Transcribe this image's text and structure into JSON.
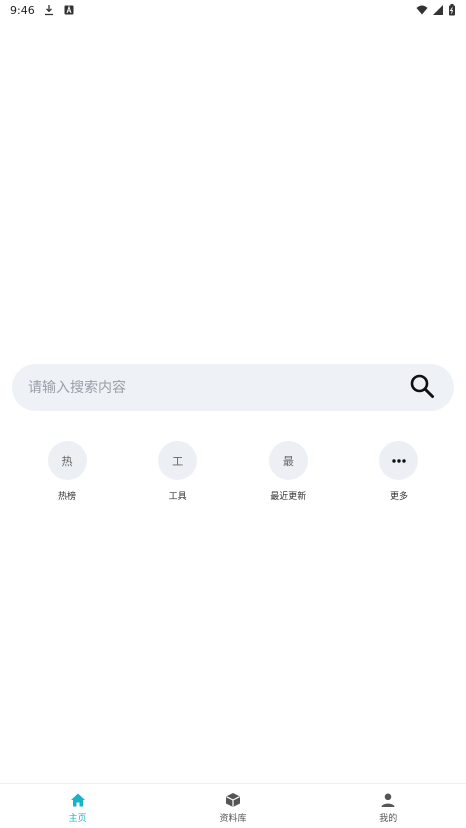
{
  "status_bar": {
    "time": "9:46",
    "icons": [
      "download-icon",
      "a-icon",
      "wifi-icon",
      "signal-icon",
      "battery-icon"
    ]
  },
  "search": {
    "placeholder": "请输入搜索内容",
    "icon": "search-icon"
  },
  "quick_actions": [
    {
      "icon_text": "热",
      "label": "热榜"
    },
    {
      "icon_text": "工",
      "label": "工具"
    },
    {
      "icon_text": "最",
      "label": "最近更新"
    },
    {
      "icon_text": "",
      "icon": "more-dots-icon",
      "label": "更多"
    }
  ],
  "bottom_nav": {
    "active_color": "#1ab4c7",
    "items": [
      {
        "label": "主页",
        "icon": "home-icon",
        "active": true
      },
      {
        "label": "资料库",
        "icon": "box-icon",
        "active": false
      },
      {
        "label": "我的",
        "icon": "person-icon",
        "active": false
      }
    ]
  }
}
